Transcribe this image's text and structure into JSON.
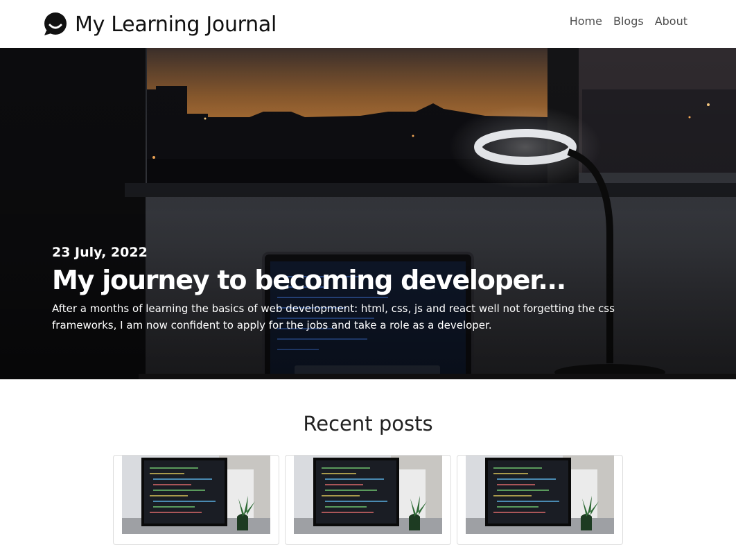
{
  "header": {
    "brand_title": "My Learning Journal",
    "brand_icon": "chat-bubble-icon",
    "nav": [
      "Home",
      "Blogs",
      "About"
    ]
  },
  "hero": {
    "date": "23 July, 2022",
    "title": "My journey to becoming developer...",
    "excerpt": "After a months of learning the basics of web development: html, css, js and react well not forgetting the css frameworks, I am now confident to apply for the jobs and take a role as a developer."
  },
  "recent": {
    "heading": "Recent posts",
    "posts": [
      {
        "image": "laptop-code-photo"
      },
      {
        "image": "laptop-code-photo"
      },
      {
        "image": "laptop-code-photo"
      }
    ]
  },
  "colors": {
    "text": "#111111",
    "nav": "#4d4d4d",
    "hero_text": "#ffffff",
    "card_border": "#dddddd"
  }
}
